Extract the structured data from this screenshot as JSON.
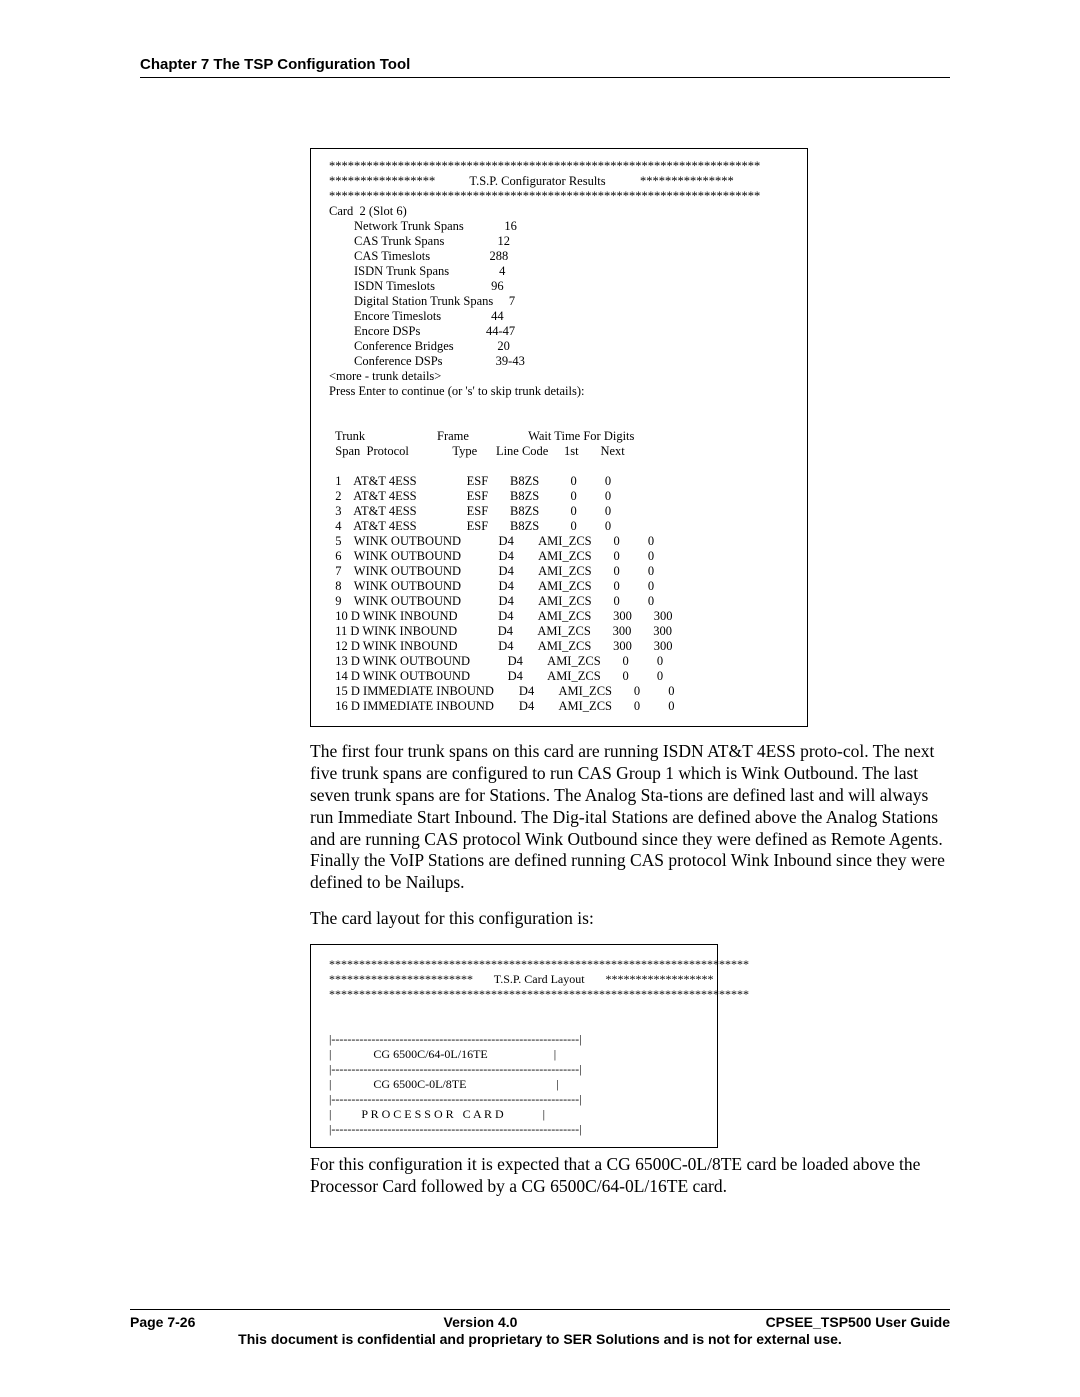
{
  "header": "Chapter 7 The TSP Configuration Tool",
  "terminal1": {
    "stars_full": "*********************************************************************",
    "title_line": "*****************           T.S.P. Configurator Results           ***************",
    "card_line": "Card  2 (Slot 6)",
    "summary": [
      {
        "label": "Network Trunk Spans",
        "value": "16"
      },
      {
        "label": "CAS Trunk Spans",
        "value": "12"
      },
      {
        "label": "CAS Timeslots",
        "value": "288"
      },
      {
        "label": "ISDN Trunk Spans",
        "value": "4"
      },
      {
        "label": "ISDN Timeslots",
        "value": "96"
      },
      {
        "label": "Digital Station Trunk Spans",
        "value": "7"
      },
      {
        "label": "Encore Timeslots",
        "value": "44"
      },
      {
        "label": "Encore DSPs",
        "value": "44-47"
      },
      {
        "label": "Conference Bridges",
        "value": "20"
      },
      {
        "label": "Conference DSPs",
        "value": "39-43"
      }
    ],
    "more_line": "<more - trunk details>",
    "press_line": "Press Enter to continue (or 's' to skip trunk details):",
    "thead1": {
      "c1": "Trunk",
      "c2": "Frame",
      "c3": "",
      "c4": "Wait Time For Digits",
      "c5": ""
    },
    "thead2": {
      "c1": "Span  Protocol",
      "c2": "Type",
      "c3": "Line Code",
      "c4": "1st",
      "c5": "Next"
    },
    "rows": [
      {
        "span": "1",
        "d": "",
        "proto": "AT&T 4ESS",
        "ftype": "ESF",
        "line": "B8ZS",
        "w1": "0",
        "w2": "0"
      },
      {
        "span": "2",
        "d": "",
        "proto": "AT&T 4ESS",
        "ftype": "ESF",
        "line": "B8ZS",
        "w1": "0",
        "w2": "0"
      },
      {
        "span": "3",
        "d": "",
        "proto": "AT&T 4ESS",
        "ftype": "ESF",
        "line": "B8ZS",
        "w1": "0",
        "w2": "0"
      },
      {
        "span": "4",
        "d": "",
        "proto": "AT&T 4ESS",
        "ftype": "ESF",
        "line": "B8ZS",
        "w1": "0",
        "w2": "0"
      },
      {
        "span": "5",
        "d": "",
        "proto": "WINK OUTBOUND",
        "ftype": "D4",
        "line": "AMI_ZCS",
        "w1": "0",
        "w2": "0"
      },
      {
        "span": "6",
        "d": "",
        "proto": "WINK OUTBOUND",
        "ftype": "D4",
        "line": "AMI_ZCS",
        "w1": "0",
        "w2": "0"
      },
      {
        "span": "7",
        "d": "",
        "proto": "WINK OUTBOUND",
        "ftype": "D4",
        "line": "AMI_ZCS",
        "w1": "0",
        "w2": "0"
      },
      {
        "span": "8",
        "d": "",
        "proto": "WINK OUTBOUND",
        "ftype": "D4",
        "line": "AMI_ZCS",
        "w1": "0",
        "w2": "0"
      },
      {
        "span": "9",
        "d": "",
        "proto": "WINK OUTBOUND",
        "ftype": "D4",
        "line": "AMI_ZCS",
        "w1": "0",
        "w2": "0"
      },
      {
        "span": "10",
        "d": "D",
        "proto": "WINK INBOUND",
        "ftype": "D4",
        "line": "AMI_ZCS",
        "w1": "300",
        "w2": "300"
      },
      {
        "span": "11",
        "d": "D",
        "proto": "WINK INBOUND",
        "ftype": "D4",
        "line": "AMI_ZCS",
        "w1": "300",
        "w2": "300"
      },
      {
        "span": "12",
        "d": "D",
        "proto": "WINK INBOUND",
        "ftype": "D4",
        "line": "AMI_ZCS",
        "w1": "300",
        "w2": "300"
      },
      {
        "span": "13",
        "d": "D",
        "proto": "WINK OUTBOUND",
        "ftype": "D4",
        "line": "AMI_ZCS",
        "w1": "0",
        "w2": "0"
      },
      {
        "span": "14",
        "d": "D",
        "proto": "WINK OUTBOUND",
        "ftype": "D4",
        "line": "AMI_ZCS",
        "w1": "0",
        "w2": "0"
      },
      {
        "span": "15",
        "d": "D",
        "proto": "IMMEDIATE INBOUND",
        "ftype": "D4",
        "line": "AMI_ZCS",
        "w1": "0",
        "w2": "0"
      },
      {
        "span": "16",
        "d": "D",
        "proto": "IMMEDIATE INBOUND",
        "ftype": "D4",
        "line": "AMI_ZCS",
        "w1": "0",
        "w2": "0"
      }
    ]
  },
  "para1": "The first four trunk spans on this card are running ISDN AT&T 4ESS proto-col.  The next five trunk spans are configured to run CAS Group 1 which is Wink Outbound. The last seven trunk spans are for Stations. The Analog Sta-tions are defined last and will always run Immediate Start Inbound.  The Dig-ital Stations are defined above the Analog Stations and are running CAS protocol Wink Outbound since they were defined as Remote Agents.  Finally the VoIP Stations are defined running CAS protocol Wink Inbound since they were defined to be Nailups.",
  "para2": "The card layout for this configuration is:",
  "terminal2": {
    "stars_full": "**********************************************************************",
    "title_line": "************************       T.S.P. Card Layout       ******************",
    "dashes": "|--------------------------------------------------------------|",
    "row1": "|              CG 6500C/64-0L/16TE                      |",
    "row2": "|              CG 6500C-0L/8TE                              |",
    "row3": "|          P R O C E S S O R   C A R D             |"
  },
  "para3": "For this configuration it is expected that a CG 6500C-0L/8TE card be loaded above the Processor Card followed by a CG 6500C/64-0L/16TE card.",
  "footer": {
    "left": "Page 7-26",
    "center": "Version 4.0",
    "right": "CPSEE_TSP500 User Guide",
    "line2": "This document is confidential and proprietary to SER Solutions and is not for external use."
  }
}
